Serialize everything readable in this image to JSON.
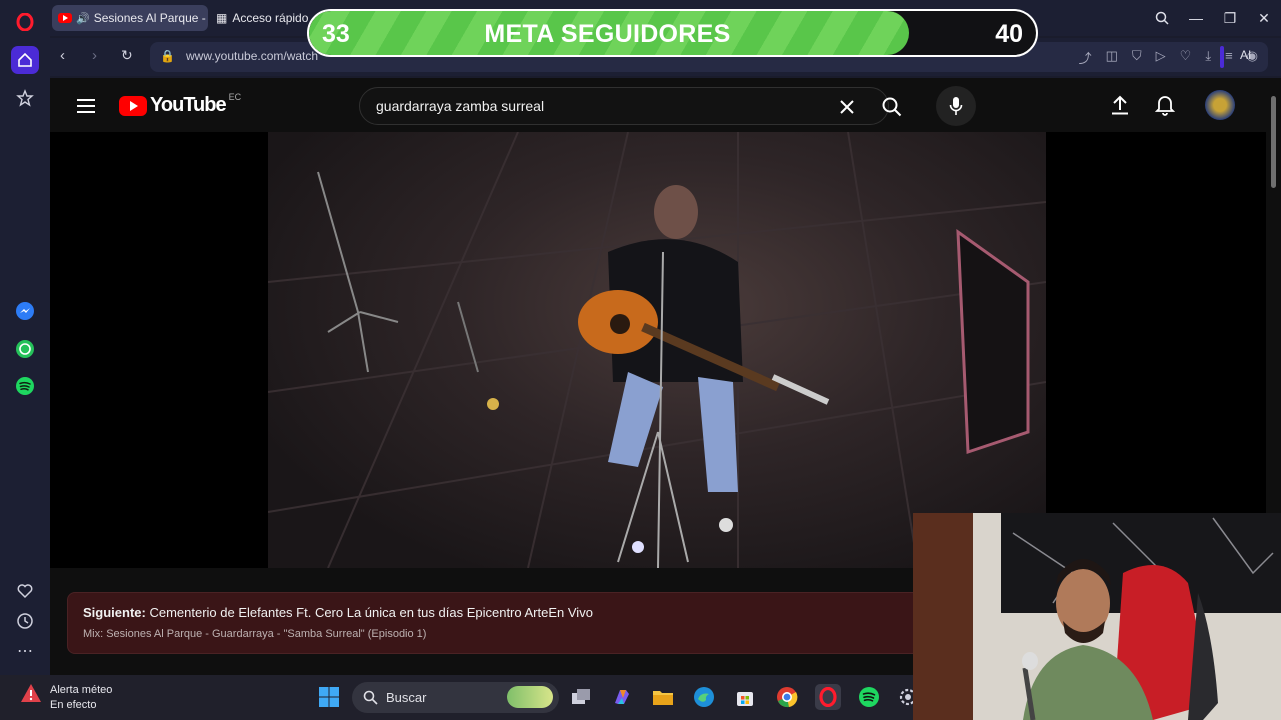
{
  "browser": {
    "tabs": [
      {
        "label": "Sesiones Al Parque - G",
        "icon": "youtube-icon"
      },
      {
        "label": "Acceso rápido",
        "icon": "grid-icon"
      }
    ],
    "url": "www.youtube.com/watch",
    "ai_label": "AI"
  },
  "stream_overlay": {
    "goal_title": "META SEGUIDORES",
    "current": "33",
    "target": "40",
    "progress": 0.825,
    "color": "#5fcb4e"
  },
  "youtube": {
    "logo_text": "YouTube",
    "country_code": "EC",
    "search_value": "guardarraya zamba surreal",
    "up_next": {
      "prefix": "Siguiente:",
      "title": "Cementerio de Elefantes Ft. Cero La única en tus días Epicentro ArteEn Vivo",
      "playlist": "Mix: Sesiones Al Parque - Guardarraya - \"Samba Surreal\" (Episodio 1)"
    }
  },
  "taskbar": {
    "weather_title": "Alerta méteo",
    "weather_subtitle": "En efecto",
    "search_label": "Buscar"
  },
  "colors": {
    "youtube_red": "#ff0000",
    "opera_red": "#ff1b2d",
    "browser_bg": "#1c1f33",
    "next_card_bg": "#3a1517"
  }
}
